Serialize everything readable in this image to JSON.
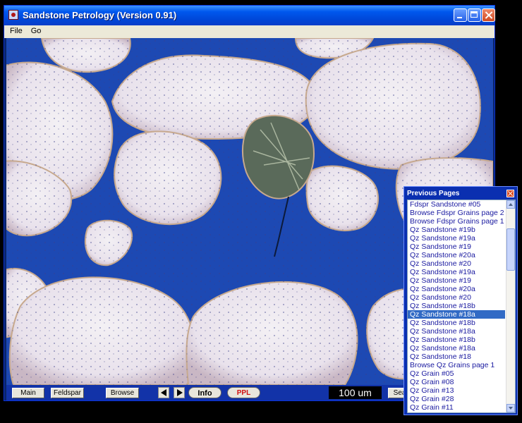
{
  "window": {
    "title": "Sandstone Petrology (Version 0.91)"
  },
  "menu": [
    "File",
    "Go"
  ],
  "toolbar": {
    "main_label": "Main",
    "feldspar_label": "Feldspar",
    "browse_label": "Browse",
    "info_label": "Info",
    "ppl_label": "PPL",
    "scale_label": "100 um",
    "search_label": "Search"
  },
  "previous_pages": {
    "title": "Previous Pages",
    "selected_index": 13,
    "items": [
      "Fdspr Sandstone #05",
      "Browse Fdspr Grains page 2",
      "Browse Fdspr Grains page 1",
      "Qz Sandstone #19b",
      "Qz Sandstone #19a",
      "Qz Sandstone #19",
      "Qz Sandstone #20a",
      "Qz Sandstone #20",
      "Qz Sandstone #19a",
      "Qz Sandstone #19",
      "Qz Sandstone #20a",
      "Qz Sandstone #20",
      "Qz Sandstone #18b",
      "Qz Sandstone #18a",
      "Qz Sandstone #18b",
      "Qz Sandstone #18a",
      "Qz Sandstone #18b",
      "Qz Sandstone #18a",
      "Qz Sandstone #18",
      "Browse Qz Grains page 1",
      "Qz Grain #05",
      "Qz Grain #08",
      "Qz Grain #13",
      "Qz Grain #28",
      "Qz Grain #11"
    ]
  }
}
